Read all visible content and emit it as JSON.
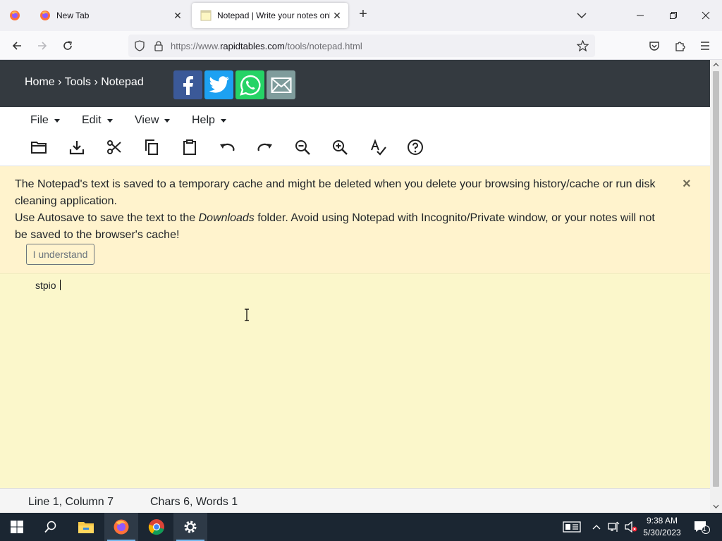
{
  "browser": {
    "tabs": [
      {
        "title": "New Tab",
        "active": false
      },
      {
        "title": "Notepad | Write your notes onli",
        "active": true
      }
    ],
    "url_prefix": "https://www.",
    "url_domain": "rapidtables.com",
    "url_path": "/tools/notepad.html"
  },
  "header": {
    "breadcrumb": [
      "Home",
      "Tools",
      "Notepad"
    ],
    "breadcrumb_separator": "›",
    "share_icons": [
      "facebook-icon",
      "twitter-icon",
      "whatsapp-icon",
      "email-icon"
    ]
  },
  "menu": {
    "items": [
      "File",
      "Edit",
      "View",
      "Help"
    ],
    "tools": [
      "open-folder-icon",
      "download-icon",
      "cut-icon",
      "copy-icon",
      "paste-icon",
      "undo-icon",
      "redo-icon",
      "zoom-out-icon",
      "zoom-in-icon",
      "spellcheck-icon",
      "help-icon"
    ]
  },
  "alert": {
    "line1": "The Notepad's text is saved to a temporary cache and might be deleted when you delete your browsing history/cache or run disk cleaning application.",
    "line2_before": "Use Autosave to save the text to the ",
    "line2_em": "Downloads",
    "line2_after": " folder. Avoid using Notepad with Incognito/Private window, or your notes will not be saved to the browser's cache!",
    "button": "I understand",
    "close": "×"
  },
  "editor": {
    "text": "stpio "
  },
  "status": {
    "position": "Line 1, Column 7",
    "counts": "Chars 6, Words 1"
  },
  "taskbar": {
    "time": "9:38 AM",
    "date": "5/30/2023",
    "notification_count": "1"
  },
  "colors": {
    "header_bg": "#343a40",
    "alert_bg": "#fff3cd",
    "editor_bg": "#fbf7cb",
    "facebook": "#3b5998",
    "twitter": "#1da1f2",
    "whatsapp": "#25d366",
    "email": "#7f9c9c"
  }
}
